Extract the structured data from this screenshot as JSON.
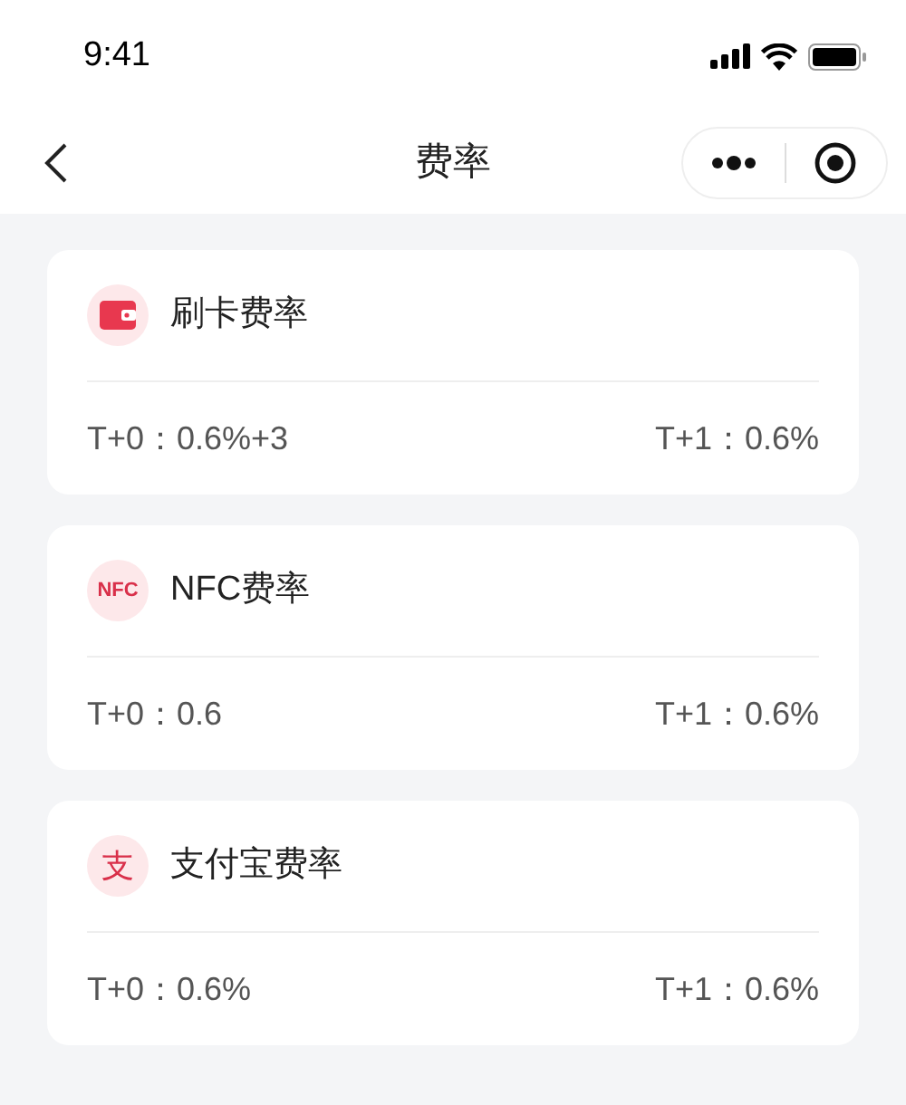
{
  "status_bar": {
    "time": "9:41"
  },
  "nav": {
    "title": "费率"
  },
  "cards": [
    {
      "icon": {
        "kind": "wallet"
      },
      "title": "刷卡费率",
      "t0": "T+0：0.6%+3",
      "t1": "T+1：0.6%"
    },
    {
      "icon": {
        "kind": "glyph",
        "text": "NFC"
      },
      "title": "NFC费率",
      "t0": "T+0：0.6",
      "t1": "T+1：0.6%"
    },
    {
      "icon": {
        "kind": "glyph",
        "text": "支"
      },
      "title": "支付宝费率",
      "t0": "T+0：0.6%",
      "t1": "T+1：0.6%"
    }
  ]
}
